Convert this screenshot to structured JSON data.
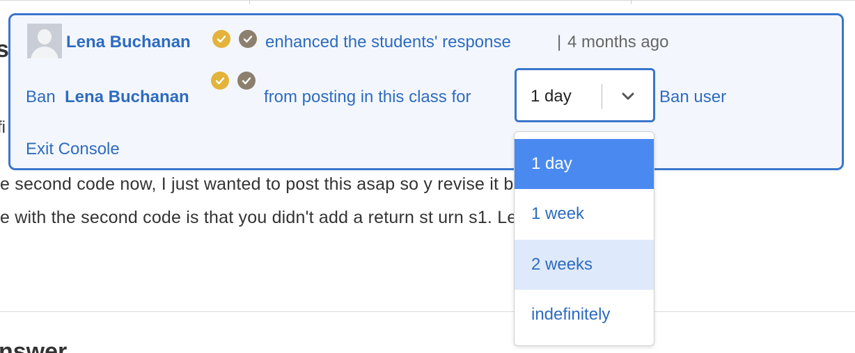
{
  "background": {
    "heading_fragment": "s",
    "fragment_fi": "fi",
    "line1": "e second code now, I just wanted to post this asap so y                              revise it before the dea",
    "line2": "e with the second code is that you didn't add a return st                              urn s1. Let me know if",
    "bottom_heading": "nswer"
  },
  "console": {
    "user_name": "Lena Buchanan",
    "action_text": "enhanced the students' response",
    "separator": "|",
    "time_ago": "4 months ago",
    "ban_prefix": "Ban",
    "ban_middle": "from posting in this class for",
    "ban_duration_selected": "1 day",
    "ban_user_link": "Ban user",
    "exit_link": "Exit Console",
    "badge_colors": {
      "endorsed": "#e3b33b",
      "verified": "#8c7f6e"
    }
  },
  "dropdown": {
    "options": [
      "1 day",
      "1 week",
      "2 weeks",
      "indefinitely"
    ],
    "selected": "1 day",
    "hovered": "2 weeks"
  },
  "colors": {
    "accent": "#3a75cc",
    "link": "#2e6bbf",
    "selected_bg": "#4a8af0",
    "hover_bg": "#deeafb",
    "console_bg": "#f3f7fd"
  }
}
